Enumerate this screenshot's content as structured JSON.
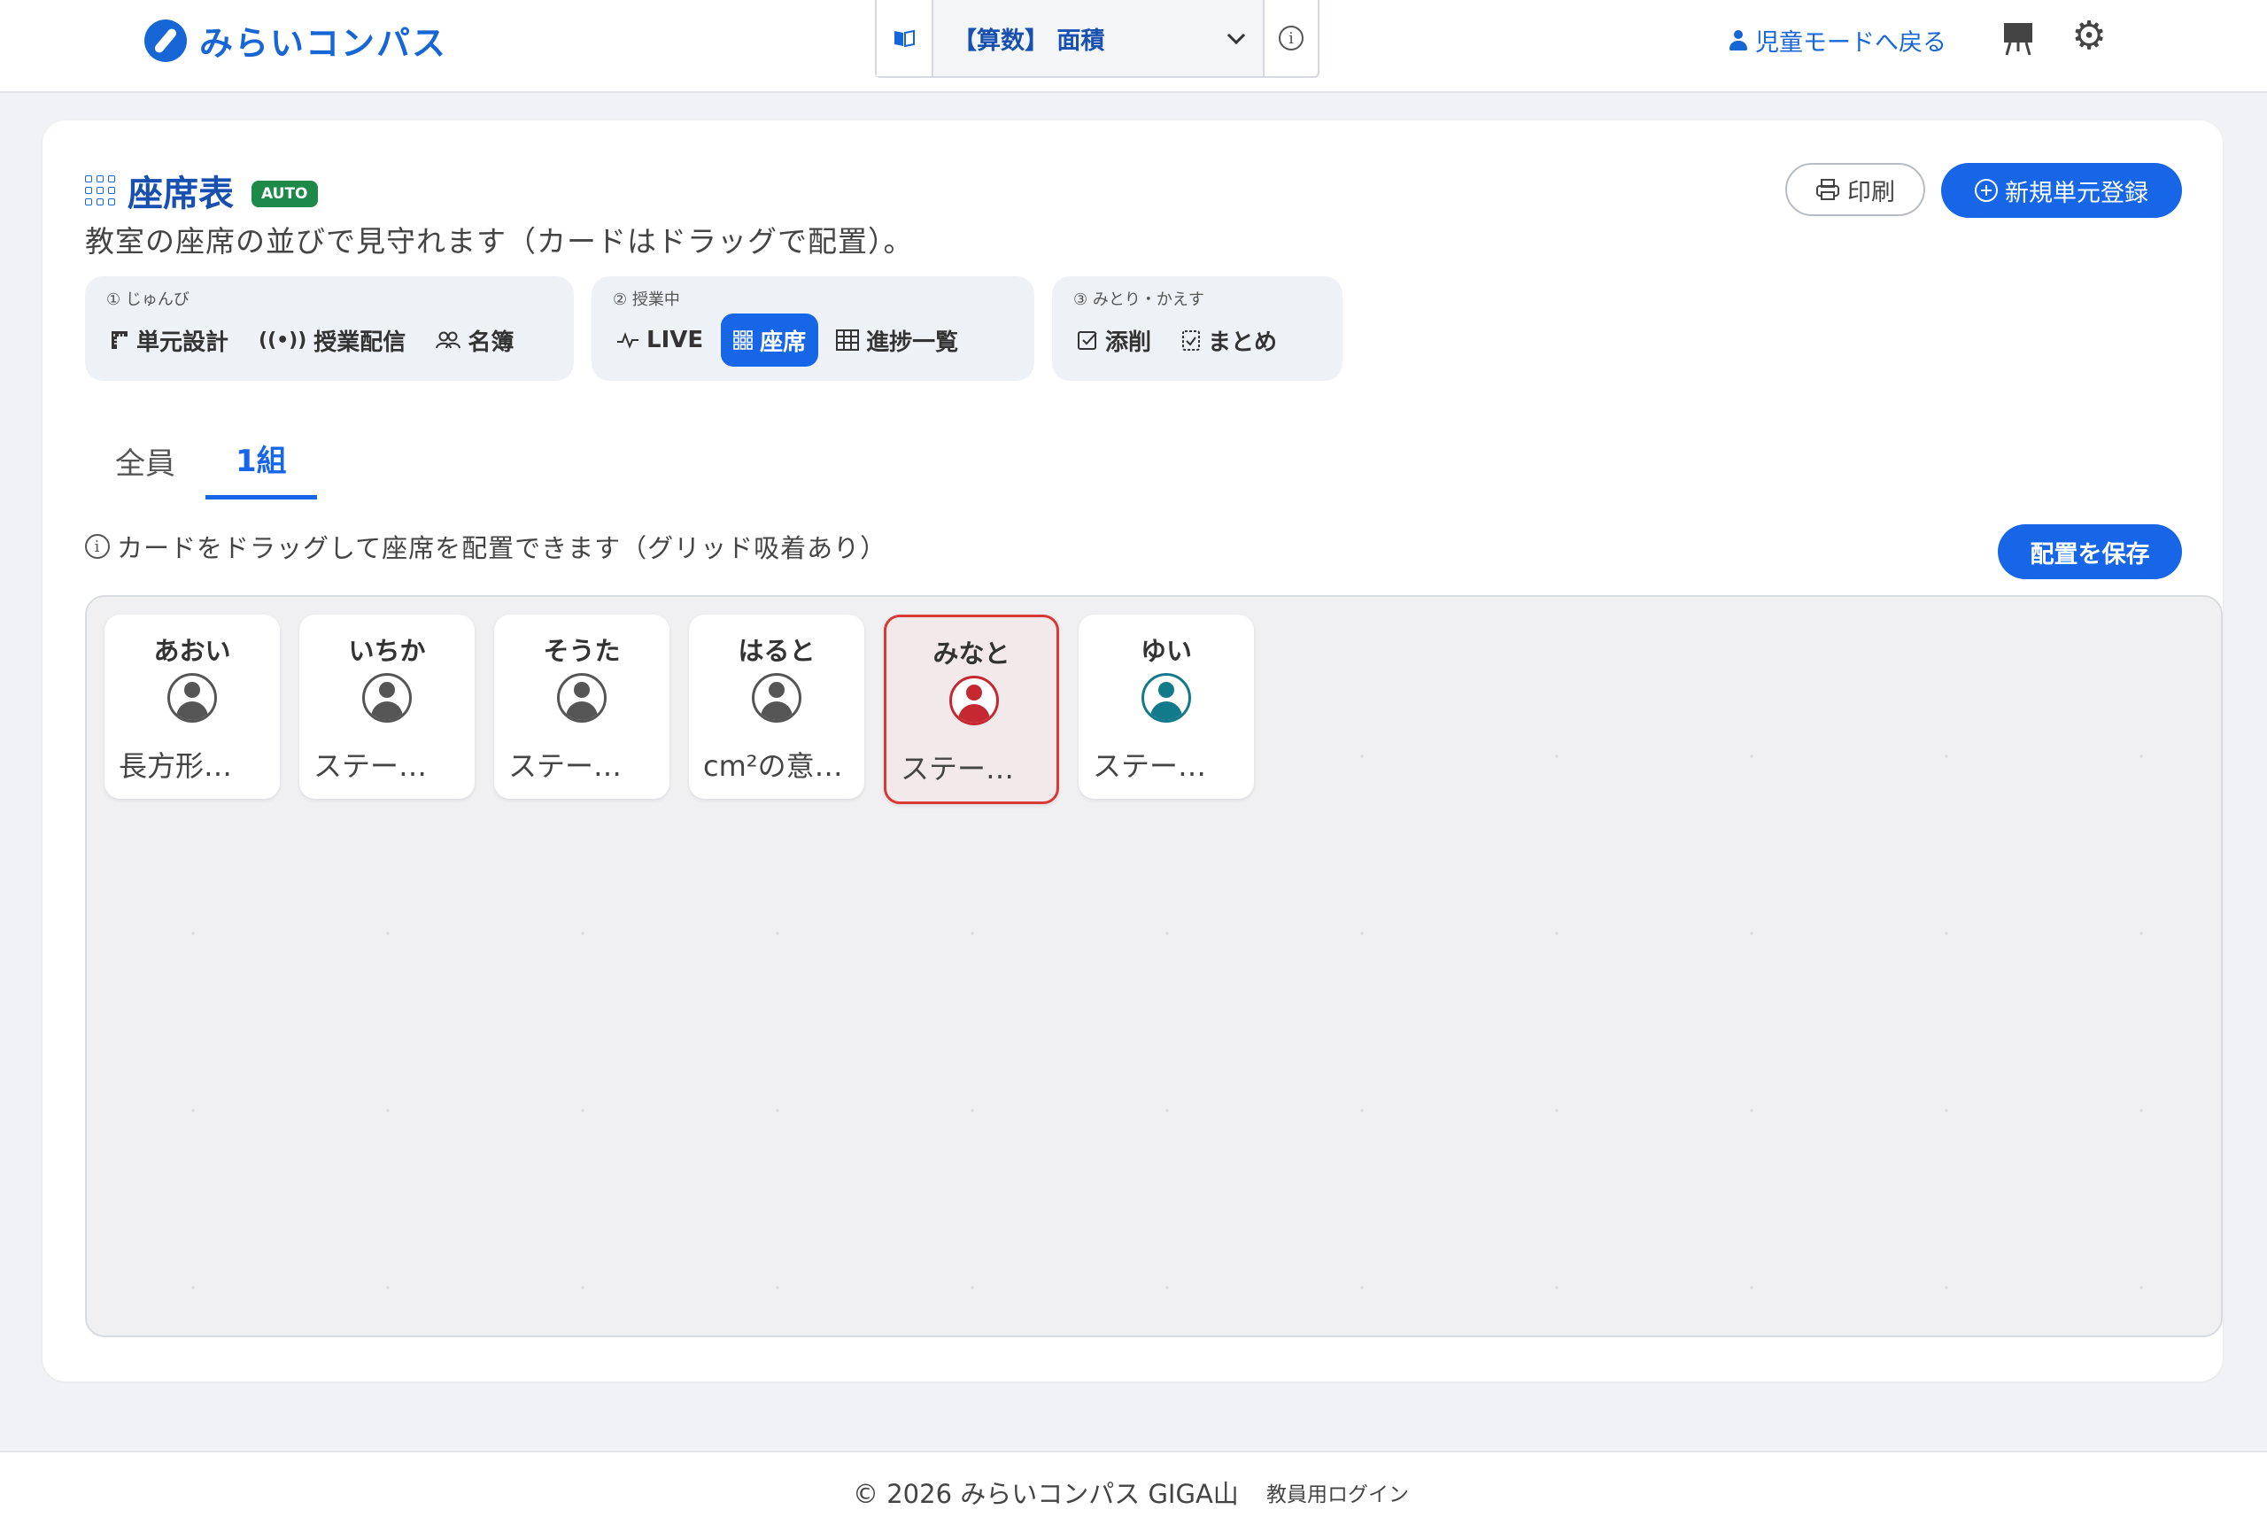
{
  "header": {
    "brand": "みらいコンパス",
    "unit_label": "【算数】 面積",
    "back_label": "児童モードへ戻る"
  },
  "page": {
    "title": "座席表",
    "badge": "AUTO",
    "subtitle": "教室の座席の並びで見守れます（カードはドラッグで配置）。",
    "print_label": "印刷",
    "new_label": "新規単元登録"
  },
  "steps": [
    {
      "caption": "① じゅんび",
      "items": [
        "単元設計",
        "授業配信",
        "名簿"
      ]
    },
    {
      "caption": "② 授業中",
      "items": [
        "LIVE",
        "座席",
        "進捗一覧"
      ]
    },
    {
      "caption": "③ みとり・かえす",
      "items": [
        "添削",
        "まとめ"
      ]
    }
  ],
  "tabs": [
    "全員",
    "1組"
  ],
  "hint": "カードをドラッグして座席を配置できます（グリッド吸着あり）",
  "save_label": "配置を保存",
  "seats": [
    {
      "name": "あおい",
      "status": "長方形…"
    },
    {
      "name": "いちか",
      "status": "ステー…"
    },
    {
      "name": "そうた",
      "status": "ステー…"
    },
    {
      "name": "はると",
      "status": "cm²の意…"
    },
    {
      "name": "みなと",
      "status": "ステー…"
    },
    {
      "name": "ゆい",
      "status": "ステー…"
    }
  ],
  "footer": {
    "copyright": "© 2026 みらいコンパス GIGA山",
    "login": "教員用ログイン"
  },
  "colors": {
    "accent": "#1766e8",
    "brand": "#1766d6",
    "auto_badge": "#1d8a4a",
    "alert": "#d93a35",
    "teal": "#127a8a"
  },
  "icons": [
    "compass-icon",
    "book-icon",
    "info-icon",
    "person-icon",
    "easel-icon",
    "gear-icon",
    "grid-icon",
    "printer-icon",
    "plus-circle-icon"
  ]
}
